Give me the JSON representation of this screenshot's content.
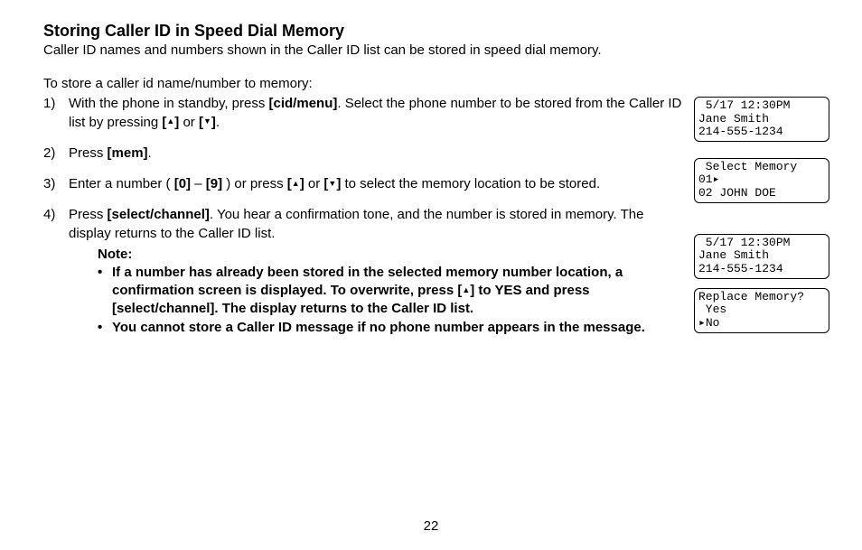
{
  "page_number": "22",
  "title": "Storing Caller ID in Speed Dial Memory",
  "intro": "Caller ID names and numbers shown in the Caller ID list can be stored in speed dial memory.",
  "lead": "To store a caller id name/number to memory:",
  "keys": {
    "cid_menu": "[cid/menu]",
    "mem": "[mem]",
    "up": "[",
    "up_close": "]",
    "down": "[",
    "down_close": "]",
    "zero": "[0]",
    "nine": "[9]",
    "select_channel": "[select/channel]"
  },
  "steps": {
    "s1_num": "1)",
    "s1_a": "With the phone in standby, press ",
    "s1_b": ". Select the phone number to be stored from the Caller ID list by pressing ",
    "s1_or": " or ",
    "s1_end": ".",
    "s2_num": "2)",
    "s2_a": "Press ",
    "s2_end": ".",
    "s3_num": "3)",
    "s3_a": "Enter a number ( ",
    "s3_dash": " – ",
    "s3_b": " ) or press ",
    "s3_or": " or ",
    "s3_c": " to select the memory location to be stored.",
    "s4_num": "4)",
    "s4_a": "Press ",
    "s4_b": ". You hear a confirmation tone, and the number is stored in memory. The display returns to the Caller ID list."
  },
  "note": {
    "heading": "Note:",
    "n1_a": "If a number has already been stored in the selected memory number location, a confirmation screen is displayed. To overwrite, press [",
    "n1_b": "] to YES and press [select/channel]. The display returns to the Caller ID list.",
    "n2": "You cannot store a Caller ID message if no phone number appears in the message."
  },
  "lcd": {
    "s1_l1": " 5/17 12:30PM",
    "s1_l2": "Jane Smith",
    "s1_l3": "214-555-1234",
    "s2_l1": " Select Memory",
    "s2_l2": "01▸",
    "s2_l3": "02 JOHN DOE",
    "s3_l1": " 5/17 12:30PM",
    "s3_l2": "Jane Smith",
    "s3_l3": "214-555-1234",
    "s4_l1": "Replace Memory?",
    "s4_l2": " Yes",
    "s4_l3": "▸No"
  }
}
